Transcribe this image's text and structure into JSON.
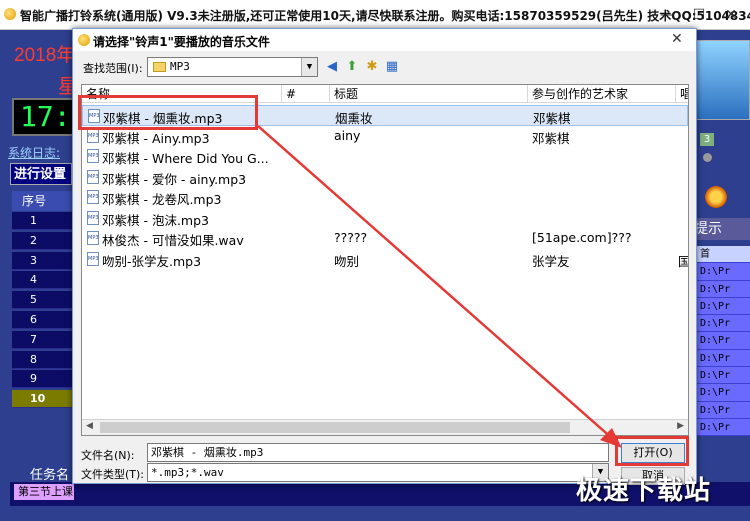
{
  "app": {
    "title": "智能广播打铃系统(通用版) V9.3未注册版,还可正常使用10天,请尽快联系注册。购买电话:15870359529(吕先生) 技术QQ:510483402",
    "minimize": "—",
    "maximize": "☐",
    "close": "✕",
    "year": "2018年",
    "weekday": "星",
    "clock": "17:",
    "syslog": "系统日志:",
    "settings_button": "进行设置",
    "seq_header": "序号",
    "seq_rows": [
      "1",
      "2",
      "3",
      "4",
      "5",
      "6",
      "7",
      "8",
      "9",
      "10"
    ],
    "task_label": "任务名",
    "third_tab": "第三节上课",
    "badge": "3",
    "hint": "提示",
    "path_col_head": "首",
    "path_cells": [
      "D:\\Pr",
      "D:\\Pr",
      "D:\\Pr",
      "D:\\Pr",
      "D:\\Pr",
      "D:\\Pr",
      "D:\\Pr",
      "D:\\Pr",
      "D:\\Pr",
      "D:\\Pr"
    ]
  },
  "dialog": {
    "title": "请选择\"铃声1\"要播放的音乐文件",
    "close": "✕",
    "lookin_label": "查找范围(I):",
    "lookin_value": "MP3",
    "toolbar": {
      "back": "◀",
      "up": "⬆",
      "new_folder": "✱",
      "view": "▦"
    },
    "columns": [
      {
        "label": "名称"
      },
      {
        "label": "#"
      },
      {
        "label": "标题"
      },
      {
        "label": "参与创作的艺术家"
      },
      {
        "label": "唱"
      }
    ],
    "files": [
      {
        "name": "邓紫棋 - 烟熏妆.mp3",
        "title": "烟熏妆",
        "artist": "邓紫棋",
        "extra": ""
      },
      {
        "name": "邓紫棋 - Ainy.mp3",
        "title": "ainy",
        "artist": "邓紫棋",
        "extra": ""
      },
      {
        "name": "邓紫棋 - Where Did You G...",
        "title": "",
        "artist": "",
        "extra": ""
      },
      {
        "name": "邓紫棋 - 爱你 - ainy.mp3",
        "title": "",
        "artist": "",
        "extra": ""
      },
      {
        "name": "邓紫棋 - 龙卷风.mp3",
        "title": "",
        "artist": "",
        "extra": ""
      },
      {
        "name": "邓紫棋 - 泡沫.mp3",
        "title": "",
        "artist": "",
        "extra": ""
      },
      {
        "name": "林俊杰 - 可惜没如果.wav",
        "title": "?????",
        "artist": "[51ape.com]???",
        "extra": ""
      },
      {
        "name": "吻别-张学友.mp3",
        "title": "吻别",
        "artist": "张学友",
        "extra": "国"
      }
    ],
    "file_icon_text": "MP3",
    "filename_label": "文件名(N):",
    "filename_value": "邓紫棋 - 烟熏妆.mp3",
    "filetype_label": "文件类型(T):",
    "filetype_value": "*.mp3;*.wav",
    "open_button": "打开(O)",
    "cancel_button": "取消"
  },
  "watermark": "极速下载站",
  "colors": {
    "highlight": "#e53935",
    "selection": "#dce8f8"
  }
}
